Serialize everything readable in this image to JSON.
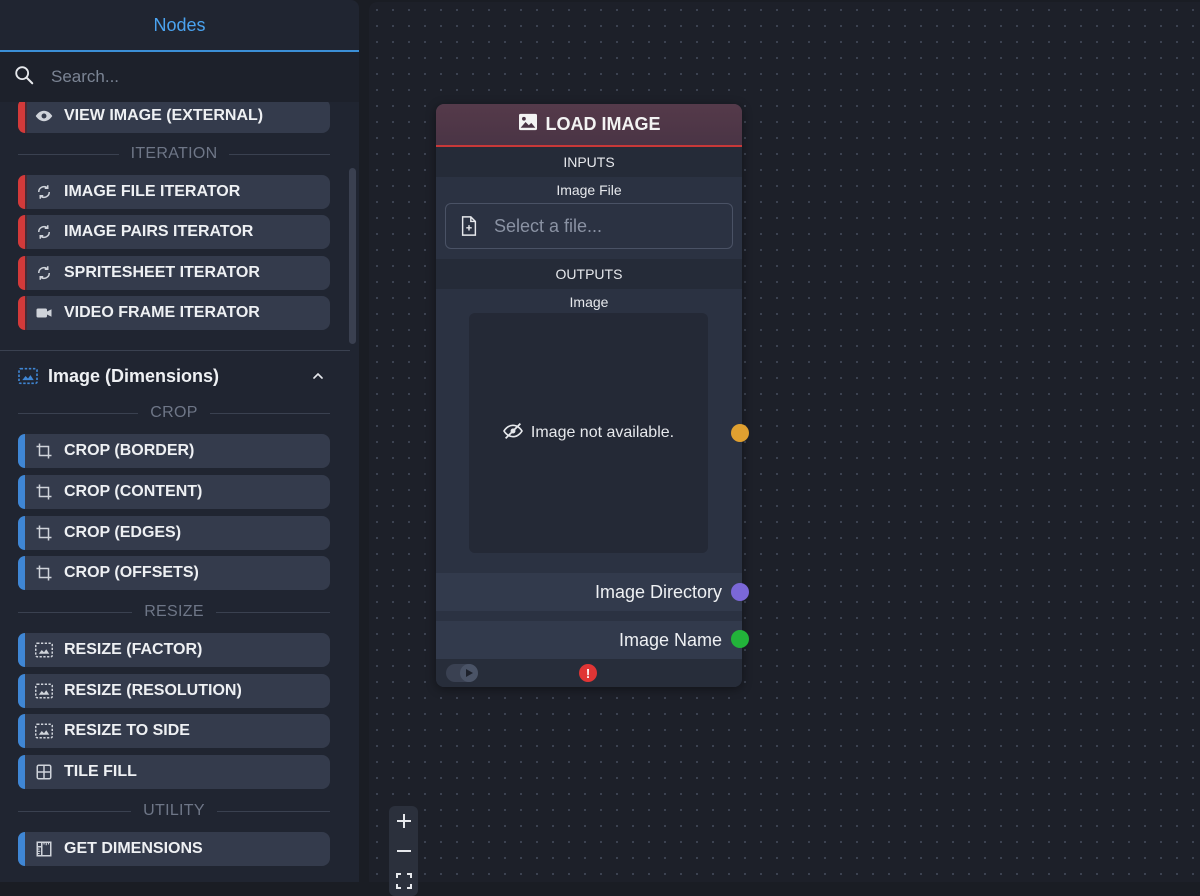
{
  "sidebar": {
    "title": "Nodes",
    "search_placeholder": "Search...",
    "top_item": {
      "label": "VIEW IMAGE (EXTERNAL)",
      "icon": "eye-icon"
    },
    "iteration_label": "ITERATION",
    "iteration_items": [
      {
        "label": "IMAGE FILE ITERATOR",
        "icon": "refresh-icon"
      },
      {
        "label": "IMAGE PAIRS ITERATOR",
        "icon": "refresh-icon"
      },
      {
        "label": "SPRITESHEET ITERATOR",
        "icon": "refresh-icon"
      },
      {
        "label": "VIDEO FRAME ITERATOR",
        "icon": "video-icon"
      }
    ],
    "category": {
      "title": "Image (Dimensions)",
      "icon": "image-dimensions-icon",
      "expanded": true
    },
    "crop_label": "CROP",
    "crop_items": [
      {
        "label": "CROP (BORDER)",
        "icon": "crop-icon"
      },
      {
        "label": "CROP (CONTENT)",
        "icon": "crop-icon"
      },
      {
        "label": "CROP (EDGES)",
        "icon": "crop-icon"
      },
      {
        "label": "CROP (OFFSETS)",
        "icon": "crop-icon"
      }
    ],
    "resize_label": "RESIZE",
    "resize_items": [
      {
        "label": "RESIZE (FACTOR)",
        "icon": "resize-icon"
      },
      {
        "label": "RESIZE (RESOLUTION)",
        "icon": "resize-icon"
      },
      {
        "label": "RESIZE TO SIDE",
        "icon": "resize-icon"
      },
      {
        "label": "TILE FILL",
        "icon": "grid-icon"
      }
    ],
    "utility_label": "UTILITY",
    "utility_items": [
      {
        "label": "GET DIMENSIONS",
        "icon": "ruler-icon"
      }
    ]
  },
  "node": {
    "title": "LOAD IMAGE",
    "inputs_label": "INPUTS",
    "image_file_label": "Image File",
    "file_placeholder": "Select a file...",
    "outputs_label": "OUTPUTS",
    "image_label": "Image",
    "image_unavailable": "Image not available.",
    "output_directory": "Image Directory",
    "output_name": "Image Name",
    "error_symbol": "!"
  },
  "colors": {
    "accent_blue": "#4aa3f0",
    "iteration_accent": "#d33a3a",
    "dimensions_accent": "#3f86d4",
    "image_handle": "#e0a030",
    "directory_handle": "#7b68d8",
    "name_handle": "#22b33a",
    "error": "#e03535"
  }
}
